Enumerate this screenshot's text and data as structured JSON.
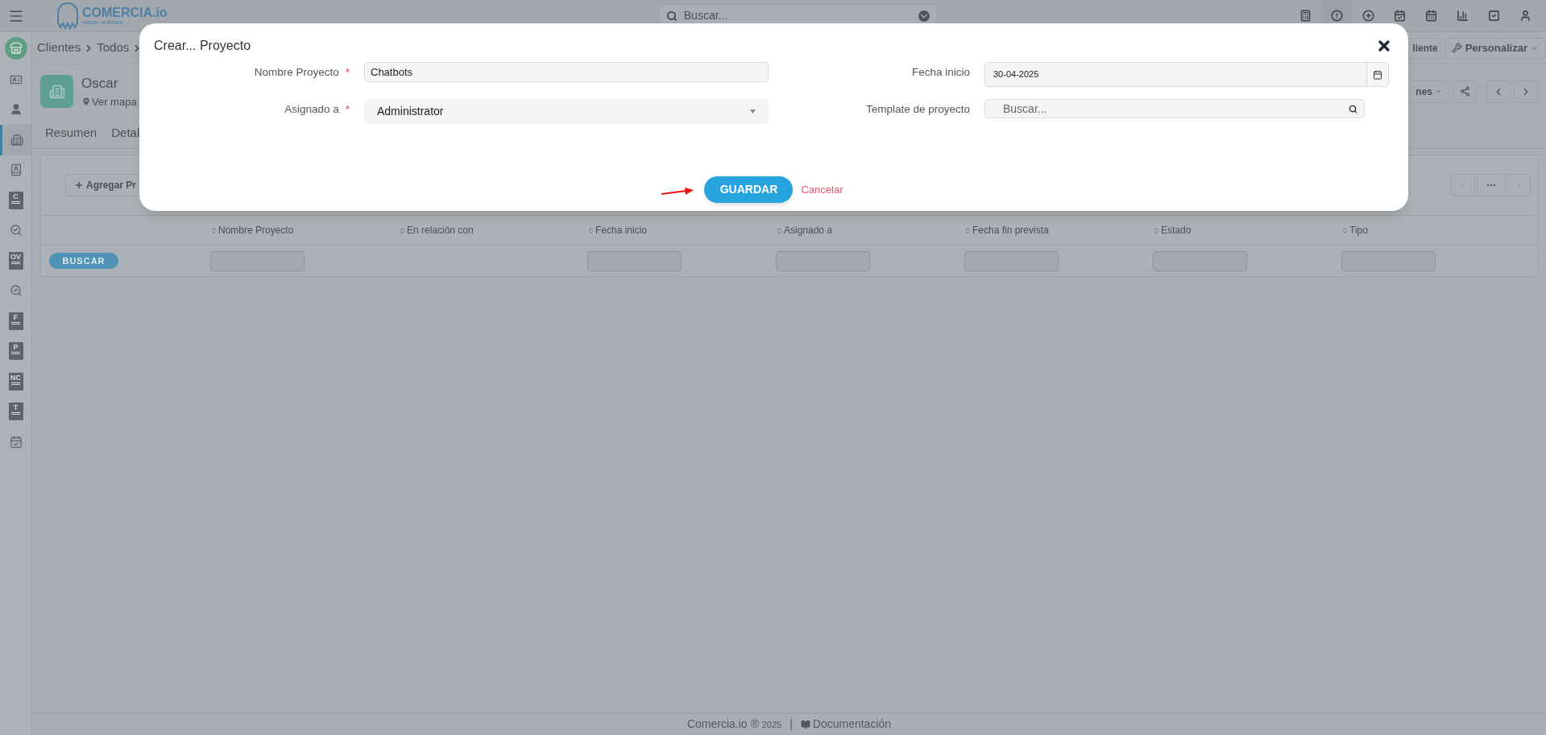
{
  "topbar": {
    "brand": "COMERCIA.io",
    "tagline": "master multitask",
    "search_placeholder": "Buscar..."
  },
  "breadcrumb": [
    "Clientes",
    "Todos"
  ],
  "header_buttons": [
    "liente",
    "Personalizar"
  ],
  "record": {
    "name": "Oscar",
    "map_link": "Ver mapa",
    "actions_menu": "nes"
  },
  "tabs": [
    {
      "label": "Resumen",
      "selected": false
    },
    {
      "label": "Detal",
      "selected": false
    }
  ],
  "sidebar": [
    {
      "kind": "card",
      "selected": false
    },
    {
      "kind": "user",
      "selected": false
    },
    {
      "kind": "building",
      "selected": true
    },
    {
      "kind": "contacts",
      "selected": false
    },
    {
      "kind": "doc",
      "glyph": "C",
      "selected": false
    },
    {
      "kind": "money-search",
      "selected": false
    },
    {
      "kind": "doc",
      "glyph": "OV",
      "selected": false
    },
    {
      "kind": "money-search",
      "selected": false
    },
    {
      "kind": "doc",
      "glyph": "F",
      "selected": false
    },
    {
      "kind": "doc",
      "glyph": "P",
      "selected": false
    },
    {
      "kind": "doc",
      "glyph": "NC",
      "selected": false
    },
    {
      "kind": "doc",
      "glyph": "T",
      "selected": false
    },
    {
      "kind": "calendar",
      "selected": false
    }
  ],
  "panel": {
    "add_button": "Agregar Pr",
    "search_button": "BUSCAR",
    "columns": [
      {
        "label": "Nombre Proyecto",
        "filter": true
      },
      {
        "label": "En relación con",
        "filter": false
      },
      {
        "label": "Fecha inicio",
        "filter": true
      },
      {
        "label": "Asignado a",
        "filter": true
      },
      {
        "label": "Fecha fin prevista",
        "filter": true
      },
      {
        "label": "Estado",
        "filter": true
      },
      {
        "label": "Tipo",
        "filter": true
      }
    ]
  },
  "modal": {
    "title": "Crear... Proyecto",
    "fields": [
      {
        "label": "Nombre Proyecto",
        "required": true,
        "kind": "text",
        "value": "Chatbots"
      },
      {
        "label": "Fecha inicio",
        "required": false,
        "kind": "date",
        "value": "30-04-2025"
      },
      {
        "label": "Asignado a",
        "required": true,
        "kind": "select",
        "value": "Administrator"
      },
      {
        "label": "Template de proyecto",
        "required": false,
        "kind": "search",
        "placeholder": "Buscar..."
      }
    ],
    "required_mark": "*",
    "save": "GUARDAR",
    "cancel": "Cancelar"
  },
  "footer": {
    "copyright": "Comercia.io ®",
    "year": "2025",
    "separator": "|",
    "docs": "Documentación"
  }
}
